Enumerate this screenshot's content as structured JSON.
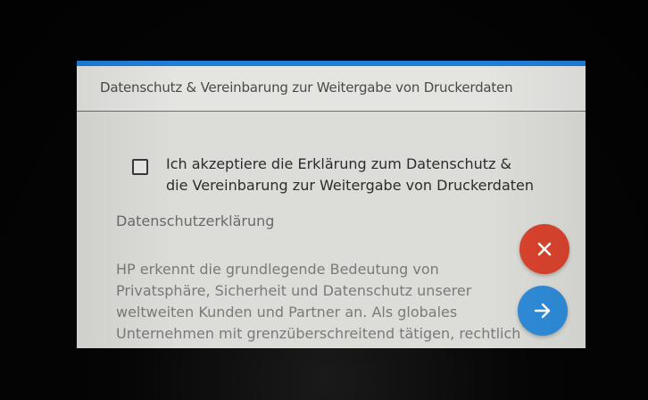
{
  "colors": {
    "accent_blue": "#1e7fd9",
    "close_red": "#d9432e",
    "next_blue": "#2f8bd8",
    "screen_bg": "#dcdcd8"
  },
  "header": {
    "title": "Datenschutz & Vereinbarung zur Weitergabe von Druckerdaten"
  },
  "accept": {
    "checked": false,
    "label_line1": "Ich akzeptiere die Erklärung zum Datenschutz &",
    "label_line2": "die Vereinbarung zur Weitergabe von Druckerdaten"
  },
  "privacy": {
    "section_title": "Datenschutzerklärung",
    "body_line1": "HP erkennt die grundlegende Bedeutung von",
    "body_line2": "Privatsphäre, Sicherheit und Datenschutz unserer",
    "body_line3": "weltweiten Kunden und Partner an. Als globales",
    "body_line4": "Unternehmen mit grenzüberschreitend tätigen, rechtlich"
  },
  "icons": {
    "close": "close-icon",
    "next": "arrow-right-icon",
    "checkbox": "checkbox-unchecked-icon"
  }
}
